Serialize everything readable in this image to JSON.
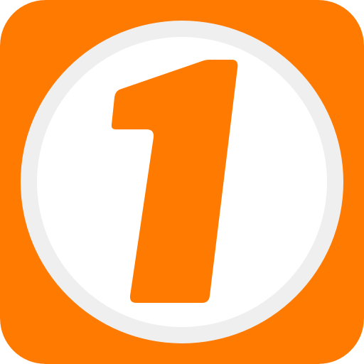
{
  "icon": {
    "name": "number-one-app-icon",
    "glyph": "1"
  },
  "colors": {
    "background": "#FF7A00",
    "ring": "#EFEFEF",
    "disc": "#FFFFFF",
    "glyph": "#FF7A00"
  }
}
